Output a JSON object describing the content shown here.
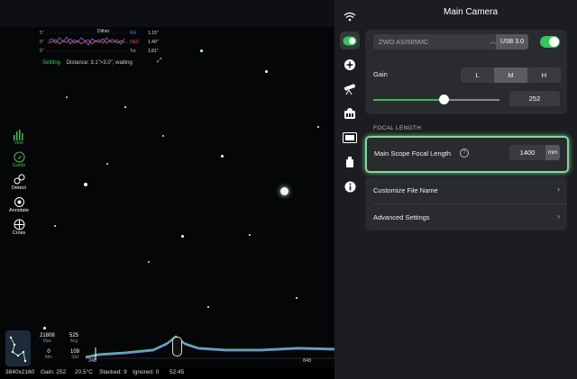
{
  "status_bar": {
    "resolution": "3840x2160",
    "gain": "Gain: 252",
    "temperature": "20.5°C",
    "stacked": "Stacked: 9",
    "ignored": "Ignored: 0",
    "time": "52:45"
  },
  "guide_graph": {
    "legend_dither": "Dither",
    "y_top": "5\"",
    "y_mid": "0\"",
    "y_bot": "5\"",
    "ra_label": "RA",
    "ra_value": "1.15\"",
    "dec_label": "DEC",
    "dec_value": "1.40\"",
    "tot_label": "Tot",
    "tot_value": "1.81\"",
    "status_word": "Settling",
    "status_detail": "Distance: 3.1\">3.0\", waiting",
    "colors": {
      "ra": "#4a7bff",
      "dec": "#ff4a4a"
    }
  },
  "tools": [
    {
      "name": "Hist",
      "icon": "histogram-icon",
      "active": true
    },
    {
      "name": "Guide",
      "icon": "guide-icon",
      "active": true
    },
    {
      "name": "Detect",
      "icon": "detect-icon",
      "active": false
    },
    {
      "name": "Annotate",
      "icon": "annotate-icon",
      "active": false
    },
    {
      "name": "Cross",
      "icon": "crosshair-icon",
      "active": false
    }
  ],
  "histogram": {
    "max_value": "21808",
    "max_label": "Max",
    "avg_value": "525",
    "avg_label": "Avg",
    "min_value": "0",
    "min_label": "Min",
    "std_value": "109",
    "std_label": "Std",
    "left_marker": "248",
    "right_marker": "848"
  },
  "panel": {
    "title": "Main Camera",
    "camera": {
      "name": "ZWO ASI585MC",
      "interface": "USB 3.0",
      "enabled": true
    },
    "gain_label": "Gain",
    "gain_presets": [
      "L",
      "M",
      "H"
    ],
    "gain_selected": "M",
    "gain_value": "252",
    "focal_section": "FOCAL LENGTH",
    "focal_label": "Main Scope Focal Length",
    "focal_help": "?",
    "focal_value": "1400",
    "focal_unit": "mm",
    "items": [
      {
        "label": "Customize File Name"
      },
      {
        "label": "Advanced Settings"
      }
    ]
  },
  "rail_icons": [
    "wifi-icon",
    "camera-toggle-icon",
    "focus-icon",
    "telescope-icon",
    "guide-cam-icon",
    "planner-icon",
    "storage-icon",
    "info-icon"
  ],
  "accent_color": "#34c759"
}
